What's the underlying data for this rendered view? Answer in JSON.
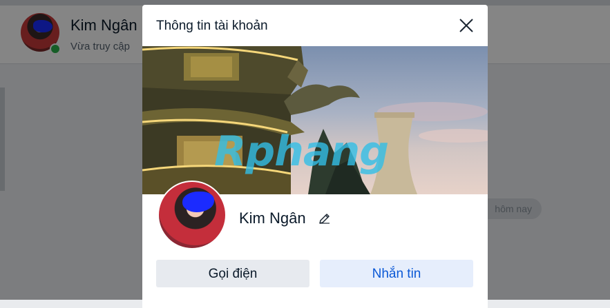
{
  "background": {
    "contact_name": "Kim Ngân",
    "contact_status": "Vừa truy cập",
    "date_pill": "hôm nay"
  },
  "modal": {
    "title": "Thông tin tài khoản",
    "close_icon": "close-icon",
    "cover_watermark": "Rphang",
    "profile_name": "Kim Ngân",
    "edit_icon": "pencil-icon",
    "call_button": "Gọi điện",
    "message_button": "Nhắn tin"
  },
  "colors": {
    "primary": "#0a58d6",
    "online": "#2bb24c",
    "overlay": "rgba(0,0,0,0.48)"
  }
}
